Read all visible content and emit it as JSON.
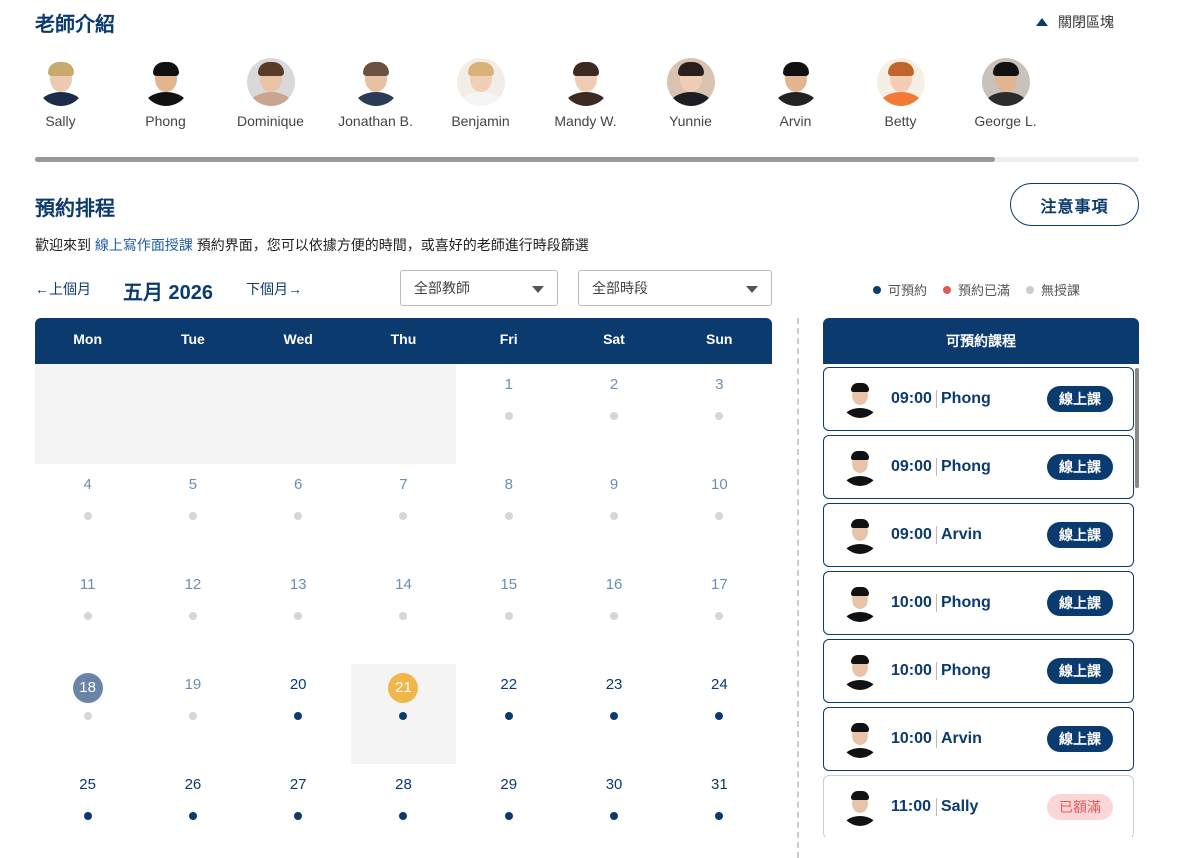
{
  "teachers_section": {
    "title": "老師介紹",
    "close_label": "關閉區塊",
    "teachers": [
      {
        "name": "Sally",
        "bg": "#ffffff",
        "skin": "#ecc9b3",
        "hair": "#c9a96e",
        "shirt": "#1c2b4a"
      },
      {
        "name": "Phong",
        "bg": "#ffffff",
        "skin": "#e2b58f",
        "hair": "#111111",
        "shirt": "#111111"
      },
      {
        "name": "Dominique",
        "bg": "#d9d9db",
        "skin": "#e9c3a6",
        "hair": "#5a3b28",
        "shirt": "#c9a58f"
      },
      {
        "name": "Jonathan B.",
        "bg": "#ffffff",
        "skin": "#e8c0a2",
        "hair": "#6b5240",
        "shirt": "#2b3b55"
      },
      {
        "name": "Benjamin",
        "bg": "#f3ede7",
        "skin": "#f1cfb6",
        "hair": "#d9b27a",
        "shirt": "#f5f5f5"
      },
      {
        "name": "Mandy W.",
        "bg": "#ffffff",
        "skin": "#efcdb5",
        "hair": "#3b2a22",
        "shirt": "#3b2a22"
      },
      {
        "name": "Yunnie",
        "bg": "#d9c2b0",
        "skin": "#efcdb5",
        "hair": "#2a1f1b",
        "shirt": "#1e1e22"
      },
      {
        "name": "Arvin",
        "bg": "#ffffff",
        "skin": "#e1b592",
        "hair": "#111111",
        "shirt": "#222222"
      },
      {
        "name": "Betty",
        "bg": "#f6efe6",
        "skin": "#f3cdb4",
        "hair": "#c0662c",
        "shirt": "#f07a36"
      },
      {
        "name": "George L.",
        "bg": "#c8c1bc",
        "skin": "#e1b592",
        "hair": "#111111",
        "shirt": "#2c2c2c"
      }
    ]
  },
  "schedule": {
    "title": "預約排程",
    "notice_button": "注意事項",
    "welcome_prefix": "歡迎來到",
    "welcome_link": "線上寫作面授課",
    "welcome_suffix": "預約界面，您可以依據方便的時間，或喜好的老師進行時段篩選",
    "prev_month": "←上個月",
    "month_label": "五月 2026",
    "next_month": "下個月→",
    "teacher_filter": "全部教師",
    "period_filter": "全部時段",
    "legend": [
      {
        "label": "可預約",
        "color": "#0b3a6e"
      },
      {
        "label": "預約已滿",
        "color": "#e05a5a"
      },
      {
        "label": "無授課",
        "color": "#cccccc"
      }
    ]
  },
  "calendar": {
    "weekdays": [
      "Mon",
      "Tue",
      "Wed",
      "Thu",
      "Fri",
      "Sat",
      "Sun"
    ],
    "colors": {
      "available": "#0b3a6e",
      "none": "#d6d6d6",
      "today": "#f0b64a",
      "selected": "#6a84a8"
    },
    "weeks": [
      [
        null,
        null,
        null,
        null,
        {
          "d": "1",
          "s": "none"
        },
        {
          "d": "2",
          "s": "none"
        },
        {
          "d": "3",
          "s": "none"
        }
      ],
      [
        {
          "d": "4",
          "s": "none"
        },
        {
          "d": "5",
          "s": "none"
        },
        {
          "d": "6",
          "s": "none"
        },
        {
          "d": "7",
          "s": "none"
        },
        {
          "d": "8",
          "s": "none"
        },
        {
          "d": "9",
          "s": "none"
        },
        {
          "d": "10",
          "s": "none"
        }
      ],
      [
        {
          "d": "11",
          "s": "none"
        },
        {
          "d": "12",
          "s": "none"
        },
        {
          "d": "13",
          "s": "none"
        },
        {
          "d": "14",
          "s": "none"
        },
        {
          "d": "15",
          "s": "none"
        },
        {
          "d": "16",
          "s": "none"
        },
        {
          "d": "17",
          "s": "none"
        }
      ],
      [
        {
          "d": "18",
          "s": "none",
          "mark": "selected"
        },
        {
          "d": "19",
          "s": "none"
        },
        {
          "d": "20",
          "s": "available"
        },
        {
          "d": "21",
          "s": "available",
          "mark": "today"
        },
        {
          "d": "22",
          "s": "available"
        },
        {
          "d": "23",
          "s": "available"
        },
        {
          "d": "24",
          "s": "available"
        }
      ],
      [
        {
          "d": "25",
          "s": "available"
        },
        {
          "d": "26",
          "s": "available"
        },
        {
          "d": "27",
          "s": "available"
        },
        {
          "d": "28",
          "s": "available"
        },
        {
          "d": "29",
          "s": "available"
        },
        {
          "d": "30",
          "s": "available"
        },
        {
          "d": "31",
          "s": "available"
        }
      ]
    ]
  },
  "slots_panel": {
    "title": "可預約課程",
    "slots": [
      {
        "time": "09:00",
        "teacher": "Phong",
        "badge": "線上課",
        "full": false
      },
      {
        "time": "09:00",
        "teacher": "Phong",
        "badge": "線上課",
        "full": false
      },
      {
        "time": "09:00",
        "teacher": "Arvin",
        "badge": "線上課",
        "full": false
      },
      {
        "time": "10:00",
        "teacher": "Phong",
        "badge": "線上課",
        "full": false
      },
      {
        "time": "10:00",
        "teacher": "Phong",
        "badge": "線上課",
        "full": false
      },
      {
        "time": "10:00",
        "teacher": "Arvin",
        "badge": "線上課",
        "full": false
      },
      {
        "time": "11:00",
        "teacher": "Sally",
        "badge": "已額滿",
        "full": true
      }
    ]
  }
}
